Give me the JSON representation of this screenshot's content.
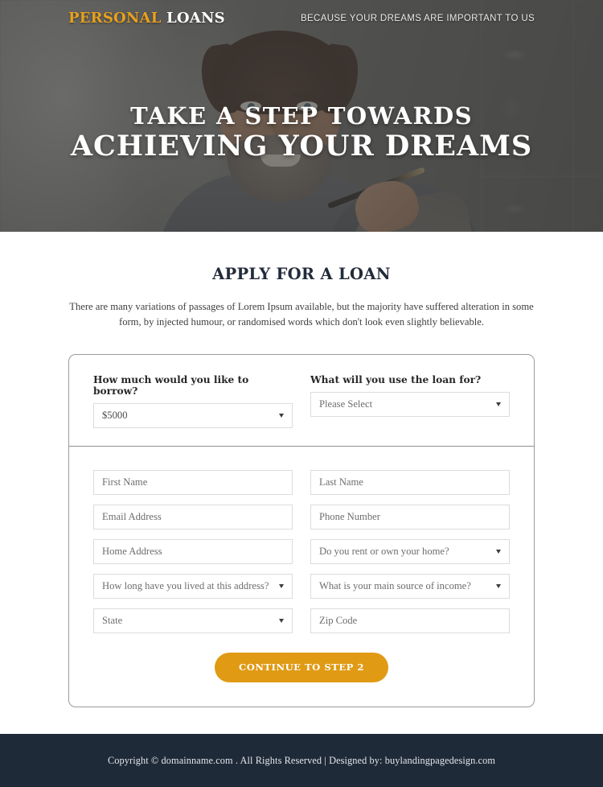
{
  "colors": {
    "brand_orange": "#e8a01c",
    "cta_orange": "#e09a14",
    "footer_navy": "#1f2a38",
    "heading_navy": "#222b3a"
  },
  "header": {
    "logo_primary": "PERSONAL",
    "logo_secondary": "LOANS",
    "tagline": "BECAUSE YOUR DREAMS ARE IMPORTANT TO US"
  },
  "hero": {
    "headline_line1": "TAKE A STEP TOWARDS",
    "headline_line2": "ACHIEVING YOUR DREAMS"
  },
  "main": {
    "title": "APPLY FOR A LOAN",
    "subtitle": "There are many variations of passages of Lorem Ipsum available, but the majority have suffered alteration in some form, by injected humour, or randomised words which don't look even slightly believable."
  },
  "form": {
    "step1": {
      "amount_label": "How much would you like to borrow?",
      "amount_value": "$5000",
      "purpose_label": "What will you use the loan for?",
      "purpose_value": "Please Select"
    },
    "fields": {
      "first_name": "First Name",
      "last_name": "Last Name",
      "email": "Email Address",
      "phone": "Phone Number",
      "home_address": "Home Address",
      "rent_or_own": "Do you rent or own your home?",
      "time_at_address": "How long have you lived at this address?",
      "income_source": "What is your main source of income?",
      "state": "State",
      "zip": "Zip Code"
    },
    "cta_label": "CONTINUE TO STEP 2"
  },
  "footer": {
    "text": "Copyright © domainname.com . All Rights Reserved | Designed by: buylandingpagedesign.com"
  }
}
